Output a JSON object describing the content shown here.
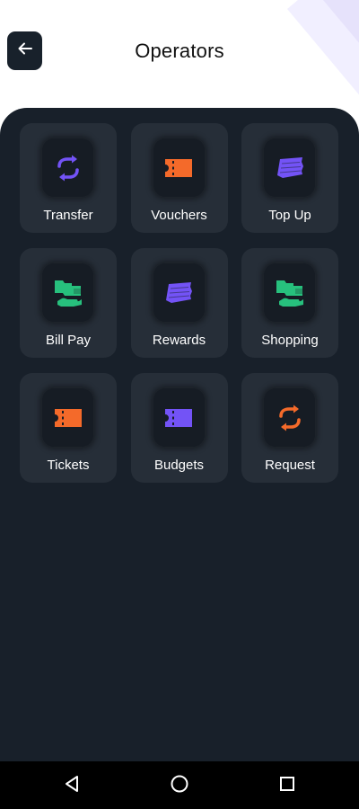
{
  "header": {
    "title": "Operators",
    "back_icon": "arrow-left-icon"
  },
  "colors": {
    "background": "#ffffff",
    "panel": "#18202a",
    "tile": "#262e38",
    "icon_box": "#161c24",
    "purple": "#7353f6",
    "orange": "#f46a2a",
    "green": "#27c07d"
  },
  "tiles": [
    {
      "label": "Transfer",
      "icon": "transfer-arrows-icon",
      "color": "#7353f6"
    },
    {
      "label": "Vouchers",
      "icon": "ticket-icon",
      "color": "#f46a2a"
    },
    {
      "label": "Top Up",
      "icon": "cash-stack-icon",
      "color": "#7353f6"
    },
    {
      "label": "Bill Pay",
      "icon": "hand-cash-icon",
      "color": "#27c07d"
    },
    {
      "label": "Rewards",
      "icon": "cash-stack-icon",
      "color": "#7353f6"
    },
    {
      "label": "Shopping",
      "icon": "hand-cash-icon",
      "color": "#27c07d"
    },
    {
      "label": "Tickets",
      "icon": "ticket-icon",
      "color": "#f46a2a"
    },
    {
      "label": "Budgets",
      "icon": "ticket-icon",
      "color": "#7353f6"
    },
    {
      "label": "Request",
      "icon": "transfer-arrows-icon",
      "color": "#f46a2a"
    }
  ],
  "navbar": {
    "back": "nav-back-icon",
    "home": "nav-home-icon",
    "recents": "nav-recents-icon"
  }
}
